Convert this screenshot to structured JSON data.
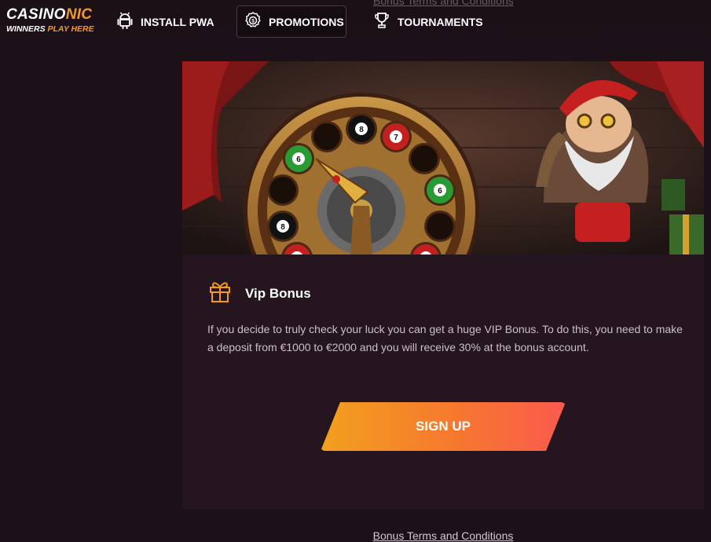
{
  "brand": {
    "name_part1": "CASINO",
    "name_part2": "NIC",
    "tagline_part1": "WINNERS ",
    "tagline_part2": "PLAY HERE"
  },
  "nav": {
    "install_pwa": "INSTALL PWA",
    "promotions": "PROMOTIONS",
    "tournaments": "TOURNAMENTS"
  },
  "bonus": {
    "title": "Vip Bonus",
    "description": "If you decide to truly check your luck you can get a huge VIP Bonus. To do this, you need to make a deposit from €1000 to €2000 and you will receive 30% at the bonus account.",
    "signup_label": "SIGN UP",
    "terms_link": "Bonus Terms and Conditions"
  },
  "icons": {
    "install": "android-icon",
    "promotions": "coin-badge-icon",
    "tournaments": "trophy-icon",
    "bonus": "gift-icon"
  },
  "colors": {
    "accent_orange": "#f39a1e",
    "button_start": "#f2a01e",
    "button_end": "#fb5a4e",
    "page_bg": "#1c1118",
    "card_bg": "#24151e"
  }
}
